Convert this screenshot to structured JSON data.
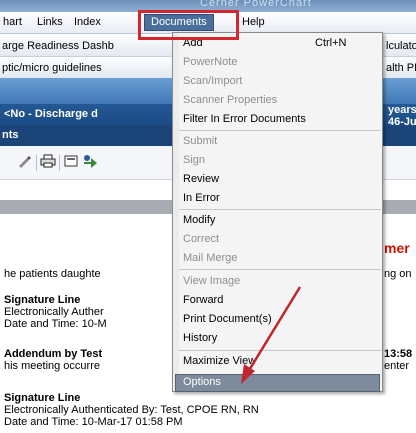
{
  "window": {
    "title_fragment": "Cerner PowerChart"
  },
  "menubar": {
    "items": [
      {
        "label": "hart"
      },
      {
        "label": "Links"
      },
      {
        "label": "Index"
      },
      {
        "label": "Documents"
      },
      {
        "label": "Help"
      }
    ]
  },
  "toolbar1": {
    "left": "arge Readiness Dashb",
    "right": "lculato"
  },
  "toolbar2": {
    "left": "ptic/micro guidelines",
    "right": "alth PE"
  },
  "banner": {
    "name_line": "<No - Discharge d",
    "right_top": "years",
    "right_bottom": "46-Jun",
    "tab": "nts"
  },
  "document": {
    "heading_fragment": "mer",
    "line1_left": "he patients daughte",
    "line1_right": "ng on",
    "sig1_title": "Signature Line",
    "sig1_l1": "Electronically Auther",
    "sig1_l2": "Date and Time: 10-M",
    "addendum_title": "Addendum by Test",
    "addendum_time": "13:58",
    "addendum_l1": "his meeting occurre",
    "addendum_l1_right": "enter",
    "sig2_title": "Signature Line",
    "sig2_l1": "Electronically Authenticated By: Test, CPOE RN, RN",
    "sig2_l2": "Date and Time: 10-Mar-17 01:58 PM"
  },
  "documents_menu": {
    "items": [
      {
        "label": "Add",
        "shortcut": "Ctrl+N",
        "enabled": true
      },
      {
        "label": "PowerNote",
        "enabled": false
      },
      {
        "label": "Scan/Import",
        "enabled": false
      },
      {
        "label": "Scanner Properties",
        "enabled": false
      },
      {
        "label": "Filter In Error Documents",
        "enabled": true
      },
      {
        "label": "Submit",
        "enabled": false
      },
      {
        "label": "Sign",
        "enabled": false
      },
      {
        "label": "Review",
        "enabled": true
      },
      {
        "label": "In Error",
        "enabled": true
      },
      {
        "label": "Modify",
        "enabled": true
      },
      {
        "label": "Correct",
        "enabled": false
      },
      {
        "label": "Mail Merge",
        "enabled": false
      },
      {
        "label": "View Image",
        "enabled": false
      },
      {
        "label": "Forward",
        "enabled": true
      },
      {
        "label": "Print Document(s)",
        "enabled": true
      },
      {
        "label": "History",
        "enabled": true
      },
      {
        "label": "Maximize View",
        "enabled": true
      },
      {
        "label": "Options",
        "enabled": true,
        "highlighted": true
      }
    ]
  },
  "colors": {
    "highlight_box": "#d6262d",
    "arrow": "#c0262c",
    "menu_selected": "#7e8b9c"
  }
}
